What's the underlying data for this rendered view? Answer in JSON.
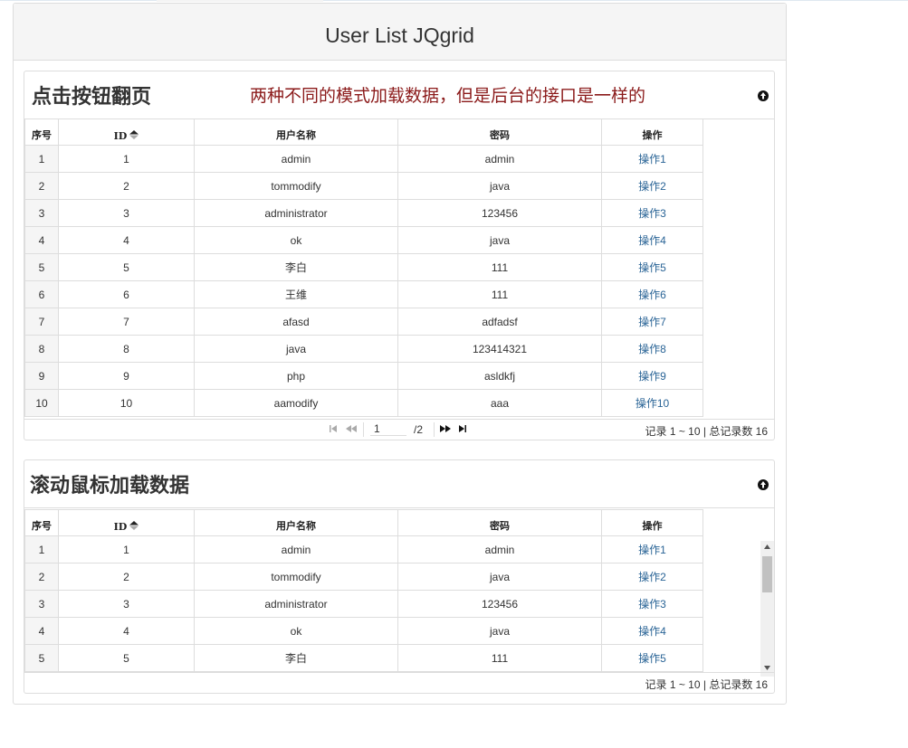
{
  "page": {
    "title": "User List JQgrid"
  },
  "columns": [
    "序号",
    "ID",
    "用户名称",
    "密码",
    "操作"
  ],
  "grid1": {
    "caption": "点击按钮翻页",
    "note": "两种不同的模式加载数据，但是后台的接口是一样的",
    "rows": [
      {
        "rn": "1",
        "id": "1",
        "name": "admin",
        "pwd": "admin",
        "op": "操作1"
      },
      {
        "rn": "2",
        "id": "2",
        "name": "tommodify",
        "pwd": "java",
        "op": "操作2"
      },
      {
        "rn": "3",
        "id": "3",
        "name": "administrator",
        "pwd": "123456",
        "op": "操作3"
      },
      {
        "rn": "4",
        "id": "4",
        "name": "ok",
        "pwd": "java",
        "op": "操作4"
      },
      {
        "rn": "5",
        "id": "5",
        "name": "李白",
        "pwd": "111",
        "op": "操作5"
      },
      {
        "rn": "6",
        "id": "6",
        "name": "王维",
        "pwd": "111",
        "op": "操作6"
      },
      {
        "rn": "7",
        "id": "7",
        "name": "afasd",
        "pwd": "adfadsf",
        "op": "操作7"
      },
      {
        "rn": "8",
        "id": "8",
        "name": "java",
        "pwd": "123414321",
        "op": "操作8"
      },
      {
        "rn": "9",
        "id": "9",
        "name": "php",
        "pwd": "asldkfj",
        "op": "操作9"
      },
      {
        "rn": "10",
        "id": "10",
        "name": "aamodify",
        "pwd": "aaa",
        "op": "操作10"
      }
    ],
    "pager": {
      "page": "1",
      "total_pages": "/2",
      "info": "记录 1 ~ 10 | 总记录数 16"
    }
  },
  "grid2": {
    "caption": "滚动鼠标加载数据",
    "rows": [
      {
        "rn": "1",
        "id": "1",
        "name": "admin",
        "pwd": "admin",
        "op": "操作1"
      },
      {
        "rn": "2",
        "id": "2",
        "name": "tommodify",
        "pwd": "java",
        "op": "操作2"
      },
      {
        "rn": "3",
        "id": "3",
        "name": "administrator",
        "pwd": "123456",
        "op": "操作3"
      },
      {
        "rn": "4",
        "id": "4",
        "name": "ok",
        "pwd": "java",
        "op": "操作4"
      },
      {
        "rn": "5",
        "id": "5",
        "name": "李白",
        "pwd": "111",
        "op": "操作5"
      }
    ],
    "pager": {
      "info": "记录 1 ~ 10 | 总记录数 16"
    }
  },
  "icons": {
    "collapse": "circle-arrow-up-icon",
    "sort": "sort-icon",
    "first": "first-page-icon",
    "prev": "prev-page-icon",
    "next": "next-page-icon",
    "last": "last-page-icon"
  },
  "colors": {
    "note": "#8b1a1a",
    "link": "#2a6496",
    "border": "#dddddd",
    "header_bg": "#f5f5f5"
  }
}
